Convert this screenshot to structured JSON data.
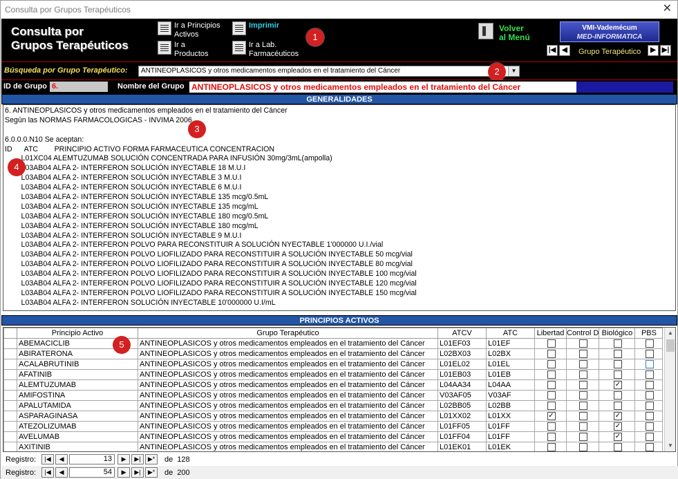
{
  "window": {
    "title": "Consulta por Grupos Terapéuticos",
    "close_glyph": "✕"
  },
  "header": {
    "title_line1": "Consulta por",
    "title_line2": "Grupos Terapéuticos",
    "btn_principios": "Ir a Principios Activos",
    "btn_principios_l1": "Ir a Principios",
    "btn_principios_l2": "Activos",
    "btn_productos_l1": "Ir a",
    "btn_productos_l2": "Productos",
    "btn_imprimir": "Imprimir",
    "btn_lab_l1": "Ir a Lab.",
    "btn_lab_l2": "Farmacéuticos",
    "volver_l1": "Volver",
    "volver_l2": "al Menú",
    "logo_l1": "VMI-Vademécum",
    "logo_l2": "MED-INFORMATICA",
    "grupo_label": "Grupo Terapéutico",
    "nav_first": "|◀",
    "nav_prev": "◀",
    "nav_next": "▶",
    "nav_last": "▶|"
  },
  "badges": [
    "1",
    "2",
    "3",
    "4",
    "5"
  ],
  "search": {
    "label": "Búsqueda por Grupo Terapéutico:",
    "value": "ANTINEOPLASICOS y otros medicamentos empleados en el tratamiento del Cáncer",
    "arrow": "▼"
  },
  "idrow": {
    "id_label": "ID de Grupo",
    "id_value": "6.",
    "nombre_label": "Nombre del Grupo",
    "nombre_value": "ANTINEOPLASICOS y otros medicamentos empleados en el tratamiento del Cáncer"
  },
  "generalidades": {
    "title": "GENERALIDADES",
    "lines": [
      "6. ANTINEOPLASICOS y otros medicamentos empleados en el tratamiento del Cáncer",
      "Según las NORMAS FARMACOLOGICAS - INVIMA 2006",
      "",
      "6.0.0.0.N10 Se aceptan:",
      "ID      ATC        PRINCIPIO ACTIVO FORMA FARMACEUTICA CONCENTRACION",
      "        L01XC04 ALEMTUZUMAB SOLUCIÓN CONCENTRADA PARA INFUSIÓN 30mg/3mL(ampolla)",
      "        L03AB04 ALFA 2- INTERFERON SOLUCIÓN INYECTABLE 18 M.U.I",
      "        L03AB04 ALFA 2- INTERFERON SOLUCIÓN INYECTABLE 3 M.U.I",
      "        L03AB04 ALFA 2- INTERFERON SOLUCIÓN INYECTABLE 6 M.U.I",
      "        L03AB04 ALFA 2- INTERFERON SOLUCIÓN INYECTABLE 135 mcg/0.5mL",
      "        L03AB04 ALFA 2- INTERFERON SOLUCIÓN INYECTABLE 135 mcg/mL",
      "        L03AB04 ALFA 2- INTERFERON SOLUCIÓN INYECTABLE 180 mcg/0.5mL",
      "        L03AB04 ALFA 2- INTERFERON SOLUCIÓN INYECTABLE 180 mcg/mL",
      "        L03AB04 ALFA 2- INTERFERON SOLUCIÓN INYECTABLE 9 M.U.I",
      "        L03AB04 ALFA 2- INTERFERON POLVO PARA RECONSTITUIR A SOLUCIÓN NYECTABLE 1'000000 U.I./vial",
      "        L03AB04 ALFA 2- INTERFERON POLVO LIOFILIZADO PARA RECONSTITUIR A SOLUCIÓN INYECTABLE 50 mcg/vial",
      "        L03AB04 ALFA 2- INTERFERON POLVO LIOFILIZADO PARA RECONSTITUIR A SOLUCIÓN INYECTABLE 80 mcg/vial",
      "        L03AB04 ALFA 2- INTERFERON POLVO LIOFILIZADO PARA RECONSTITUIR A SOLUCIÓN INYECTABLE 100 mcg/vial",
      "        L03AB04 ALFA 2- INTERFERON POLVO LIOFILIZADO PARA RECONSTITUIR A SOLUCIÓN INYECTABLE 120 mcg/vial",
      "        L03AB04 ALFA 2- INTERFERON POLVO LIOFILIZADO PARA RECONSTITUIR A SOLUCIÓN INYECTABLE 150 mcg/vial",
      "        L03AB04 ALFA 2- INTERFERON SOLUCIÓN INYECTABLE 10'000000 U.I/mL"
    ]
  },
  "principios": {
    "title": "PRINCIPIOS ACTIVOS",
    "columns": [
      "Principio Activo",
      "Grupo Terapéutico",
      "ATCV",
      "ATC",
      "Libertad",
      "Control D",
      "Biológico",
      "PBS"
    ],
    "rows": [
      {
        "principio": "ABEMACICLIB",
        "grupo": "ANTINEOPLASICOS y otros medicamentos empleados en el tratamiento del Cáncer",
        "atcv": "L01EF03",
        "atc": "L01EF",
        "libertad": false,
        "control": false,
        "biologico": false,
        "pbs": false
      },
      {
        "principio": "ABIRATERONA",
        "grupo": "ANTINEOPLASICOS y otros medicamentos empleados en el tratamiento del Cáncer",
        "atcv": "L02BX03",
        "atc": "L02BX",
        "libertad": false,
        "control": false,
        "biologico": false,
        "pbs": false
      },
      {
        "principio": "ACALABRUTINIB",
        "grupo": "ANTINEOPLASICOS y otros medicamentos empleados en el tratamiento del Cáncer",
        "atcv": "L01EL02",
        "atc": "L01EL",
        "libertad": false,
        "control": false,
        "biologico": false,
        "pbs": false
      },
      {
        "principio": "AFATINIB",
        "grupo": "ANTINEOPLASICOS y otros medicamentos empleados en el tratamiento del Cáncer",
        "atcv": "L01EB03",
        "atc": "L01EB",
        "libertad": false,
        "control": false,
        "biologico": false,
        "pbs": false
      },
      {
        "principio": "ALEMTUZUMAB",
        "grupo": "ANTINEOPLASICOS y otros medicamentos empleados en el tratamiento del Cáncer",
        "atcv": "L04AA34",
        "atc": "L04AA",
        "libertad": false,
        "control": false,
        "biologico": true,
        "pbs": false
      },
      {
        "principio": "AMIFOSTINA",
        "grupo": "ANTINEOPLASICOS y otros medicamentos empleados en el tratamiento del Cáncer",
        "atcv": "V03AF05",
        "atc": "V03AF",
        "libertad": false,
        "control": false,
        "biologico": false,
        "pbs": false
      },
      {
        "principio": "APALUTAMIDA",
        "grupo": "ANTINEOPLASICOS y otros medicamentos empleados en el tratamiento del Cáncer",
        "atcv": "L02BB05",
        "atc": "L02BB",
        "libertad": false,
        "control": false,
        "biologico": false,
        "pbs": false
      },
      {
        "principio": "ASPARAGINASA",
        "grupo": "ANTINEOPLASICOS y otros medicamentos empleados en el tratamiento del Cáncer",
        "atcv": "L01XX02",
        "atc": "L01XX",
        "libertad": true,
        "control": false,
        "biologico": true,
        "pbs": false
      },
      {
        "principio": "ATEZOLIZUMAB",
        "grupo": "ANTINEOPLASICOS y otros medicamentos empleados en el tratamiento del Cáncer",
        "atcv": "L01FF05",
        "atc": "L01FF",
        "libertad": false,
        "control": false,
        "biologico": true,
        "pbs": false
      },
      {
        "principio": "AVELUMAB",
        "grupo": "ANTINEOPLASICOS y otros medicamentos empleados en el tratamiento del Cáncer",
        "atcv": "L01FF04",
        "atc": "L01FF",
        "libertad": false,
        "control": false,
        "biologico": true,
        "pbs": false
      },
      {
        "principio": "AXITINIB",
        "grupo": "ANTINEOPLASICOS y otros medicamentos empleados en el tratamiento del Cáncer",
        "atcv": "L01EK01",
        "atc": "L01EK",
        "libertad": false,
        "control": false,
        "biologico": false,
        "pbs": false
      }
    ]
  },
  "subnav": {
    "label": "Registro:",
    "current": "13",
    "of": "de",
    "total": "128",
    "first": "|◀",
    "prev": "◀",
    "next": "▶",
    "last": "▶|",
    "new": "▶*"
  },
  "mainnav": {
    "label": "Registro:",
    "current": "54",
    "of": "de",
    "total": "200",
    "first": "|◀",
    "prev": "◀",
    "next": "▶",
    "last": "▶|",
    "new": "▶*"
  },
  "colors": {
    "header_bg": "#000000",
    "section_bar": "#2255a6",
    "accent_red": "#e01010",
    "badge_red": "#d32020",
    "label_yellow": "#f1e05a"
  },
  "icons": {
    "check": "✓",
    "scroll_up": "▲",
    "scroll_down": "▼"
  }
}
